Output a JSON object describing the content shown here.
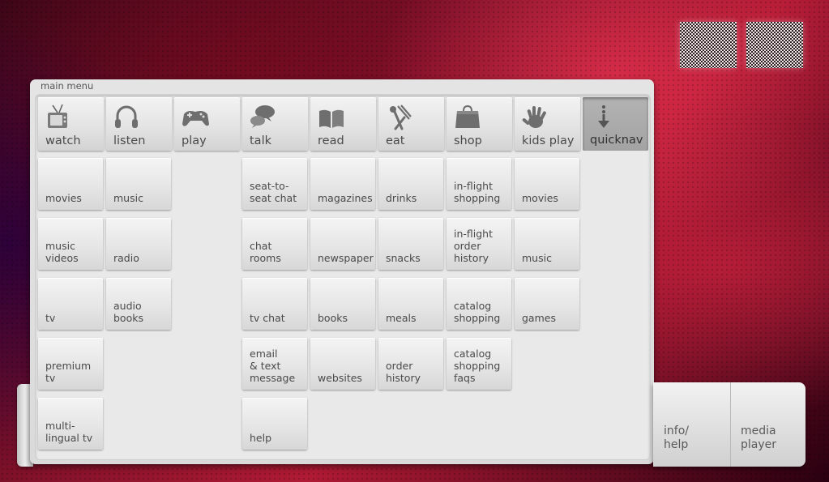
{
  "panel": {
    "title": "main menu"
  },
  "categories": [
    {
      "label": "watch",
      "icon": "tv-icon"
    },
    {
      "label": "listen",
      "icon": "headphones-icon"
    },
    {
      "label": "play",
      "icon": "gamepad-icon"
    },
    {
      "label": "talk",
      "icon": "chat-bubbles-icon"
    },
    {
      "label": "read",
      "icon": "book-icon"
    },
    {
      "label": "eat",
      "icon": "utensils-icon"
    },
    {
      "label": "shop",
      "icon": "shopping-bag-icon"
    },
    {
      "label": "kids play",
      "icon": "handprint-icon"
    },
    {
      "label": "quicknav",
      "icon": "arrow-down-icon",
      "active": true
    }
  ],
  "columns": {
    "watch": [
      "movies",
      "music videos",
      "tv",
      "premium tv",
      "multi-lingual tv"
    ],
    "listen": [
      "music",
      "radio",
      "audio books"
    ],
    "talk": [
      "seat-to-seat chat",
      "chat rooms",
      "tv chat",
      "email & text message",
      "help"
    ],
    "read": [
      "magazines",
      "newspaper",
      "books",
      "websites"
    ],
    "eat": [
      "drinks",
      "snacks",
      "meals",
      "order history"
    ],
    "shop": [
      "in-flight shopping",
      "in-flight order history",
      "catalog shopping",
      "catalog shopping faqs"
    ],
    "kids_play": [
      "movies",
      "music",
      "games"
    ]
  },
  "bottom": {
    "info_help": "info/ help",
    "media_player": "media player"
  }
}
